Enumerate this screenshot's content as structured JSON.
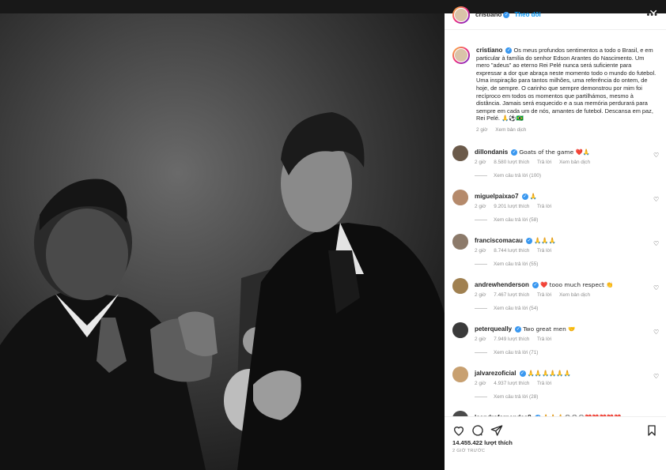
{
  "post": {
    "username": "cristiano",
    "follow_label": "Theo dõi",
    "verified": true,
    "caption": "Os meus profundos sentimentos a todo o Brasil, e em particular à família do senhor Edson Arantes do Nascimento. Um mero \"adeus\" ao eterno Rei Pelé nunca será suficiente para expressar a dor que abraça neste momento todo o mundo do futebol. Uma inspiração para tantos milhões, uma referência do ontem, de hoje, de sempre. O carinho que sempre demonstrou por mim foi recíproco em todos os momentos que partilhámos, mesmo à distância. Jamais será esquecido e a sua memória perdurará para sempre em cada um de nós, amantes de futebol. Descansa em paz, Rei Pelé. 🙏⚽🇧🇷",
    "caption_time": "2 giờ",
    "see_translation": "Xem bản dịch",
    "likes": "14.455.422 lượt thích",
    "posted": "2 GIỜ TRƯỚC"
  },
  "comments": [
    {
      "user": "dillondanis",
      "verified": true,
      "text": "Goats of the game ❤️🙏",
      "time": "2 giờ",
      "likes": "8.580 lượt thích",
      "reply": "Trả lời",
      "translate": "Xem bản dịch",
      "replies": "Xem câu trả lời (100)"
    },
    {
      "user": "miguelpaixao7",
      "verified": true,
      "text": "🙏",
      "time": "2 giờ",
      "likes": "9.201 lượt thích",
      "reply": "Trả lời",
      "translate": "",
      "replies": "Xem câu trả lời (58)"
    },
    {
      "user": "franciscomacau",
      "verified": true,
      "text": "🙏🙏🙏",
      "time": "2 giờ",
      "likes": "8.744 lượt thích",
      "reply": "Trả lời",
      "translate": "",
      "replies": "Xem câu trả lời (55)"
    },
    {
      "user": "andrewhenderson",
      "verified": true,
      "text": "❤️ tooo much respect 👏",
      "time": "2 giờ",
      "likes": "7.467 lượt thích",
      "reply": "Trả lời",
      "translate": "Xem bản dịch",
      "replies": "Xem câu trả lời (54)"
    },
    {
      "user": "peterqueally",
      "verified": true,
      "text": "Two great men 🤝",
      "time": "2 giờ",
      "likes": "7.949 lượt thích",
      "reply": "Trả lời",
      "translate": "",
      "replies": "Xem câu trả lời (71)"
    },
    {
      "user": "jalvarezoficial",
      "verified": true,
      "text": "🙏🙏🙏🙏🙏🙏",
      "time": "2 giờ",
      "likes": "4.937 lượt thích",
      "reply": "Trả lời",
      "translate": "",
      "replies": "Xem câu trả lời (28)"
    },
    {
      "user": "leandrofernandes8",
      "verified": true,
      "text": "🙏🙏🙏😭😭😭❤️❤️❤️❤️❤️",
      "time": "",
      "likes": "",
      "reply": "",
      "translate": "",
      "replies": ""
    }
  ],
  "icons": {
    "like": "heart-icon",
    "comment": "comment-icon",
    "share": "share-icon",
    "save": "bookmark-icon",
    "more": "more-icon",
    "close": "close-icon"
  },
  "colors": {
    "accent": "#0095f6",
    "verified": "#3897f0",
    "text": "#262626",
    "muted": "#8e8e8e"
  }
}
